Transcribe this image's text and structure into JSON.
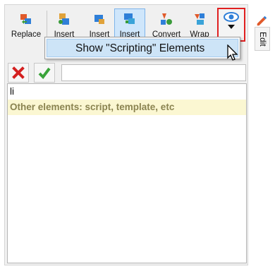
{
  "toolbar": {
    "replace_label": "Replace",
    "insert1_label": "Insert",
    "insert2_label": "Insert",
    "insert3_label": "Insert",
    "convert_label": "Convert",
    "wrap_label": "Wrap"
  },
  "dropdown": {
    "item_label": "Show \"Scripting\" Elements"
  },
  "filter": {
    "value": "",
    "placeholder": ""
  },
  "list": {
    "items": [
      "li",
      "Other elements: script, template, etc"
    ]
  },
  "side": {
    "tab_label": "Edit"
  },
  "colors": {
    "accent": "#cde4f7",
    "highlight_border": "#e02020",
    "hint_bg": "#fbf7d2"
  }
}
